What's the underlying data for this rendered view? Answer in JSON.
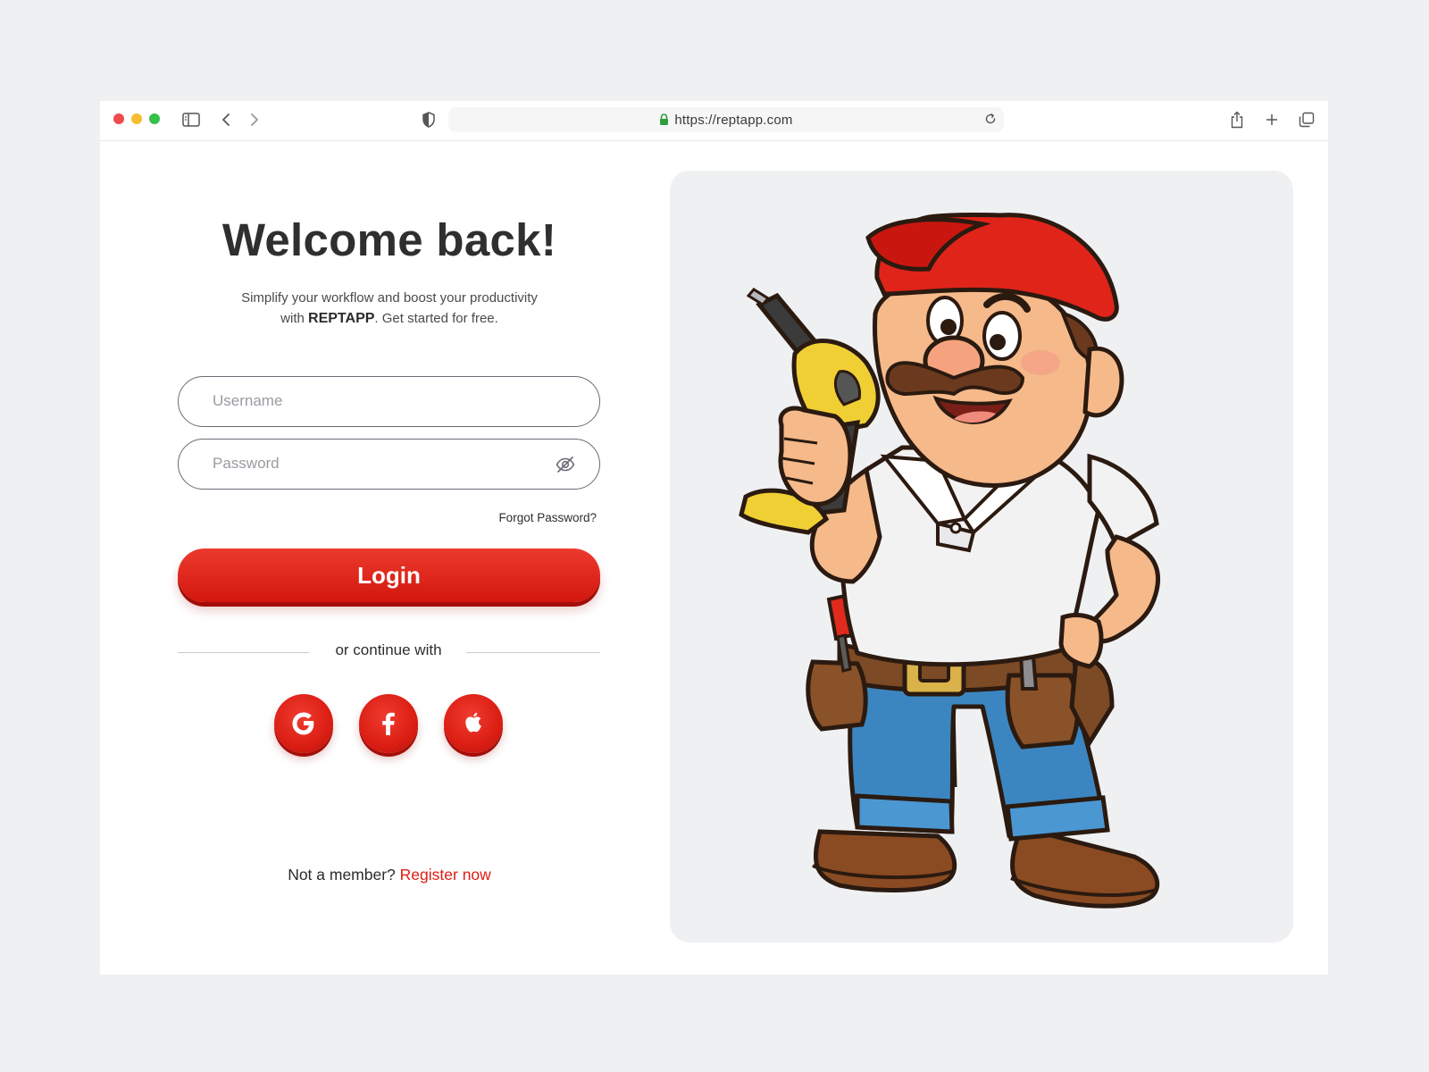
{
  "browser": {
    "url": "https://reptapp.com"
  },
  "login": {
    "title": "Welcome back!",
    "subtitle_line1": "Simplify your workflow and boost your productivity",
    "subtitle_with": "with",
    "brand": "REPTAPP",
    "subtitle_tail": ". Get started for free.",
    "username_placeholder": "Username",
    "password_placeholder": "Password",
    "forgot_label": "Forgot Password?",
    "login_label": "Login",
    "divider_text": "or continue with",
    "social": [
      "google-icon",
      "facebook-icon",
      "apple-icon"
    ],
    "register_prompt": "Not a member?",
    "register_link": "Register now"
  },
  "colors": {
    "accent": "#d81b12",
    "panel_bg": "#eff0f2",
    "text": "#2b2b2b"
  }
}
